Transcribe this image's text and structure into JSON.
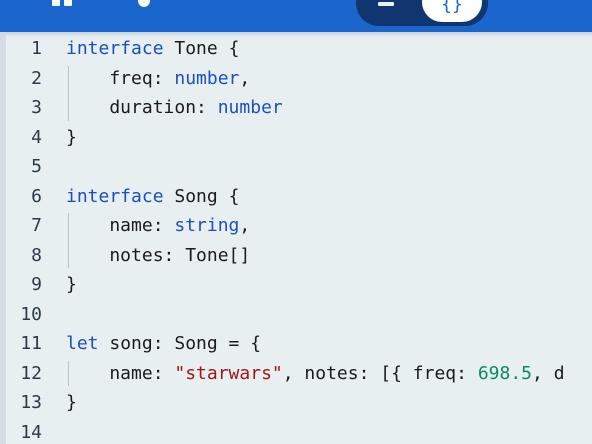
{
  "toolbar": {
    "toggle_icon": "{}",
    "icons": [
      "blocks-icon",
      "blocks-toggle-icon",
      "javascript-braces-icon"
    ]
  },
  "editor": {
    "lines": [
      {
        "number": "1",
        "parts": [
          {
            "t": "interface",
            "c": "kw"
          },
          {
            "t": " Tone {",
            "c": ""
          }
        ]
      },
      {
        "number": "2",
        "parts": [
          {
            "t": "    freq: ",
            "c": ""
          },
          {
            "t": "number",
            "c": "ty"
          },
          {
            "t": ",",
            "c": ""
          }
        ]
      },
      {
        "number": "3",
        "parts": [
          {
            "t": "    duration: ",
            "c": ""
          },
          {
            "t": "number",
            "c": "ty"
          }
        ]
      },
      {
        "number": "4",
        "parts": [
          {
            "t": "}",
            "c": ""
          }
        ]
      },
      {
        "number": "5",
        "parts": []
      },
      {
        "number": "6",
        "parts": [
          {
            "t": "interface",
            "c": "kw"
          },
          {
            "t": " Song {",
            "c": ""
          }
        ]
      },
      {
        "number": "7",
        "parts": [
          {
            "t": "    name: ",
            "c": ""
          },
          {
            "t": "string",
            "c": "ty"
          },
          {
            "t": ",",
            "c": ""
          }
        ]
      },
      {
        "number": "8",
        "parts": [
          {
            "t": "    notes: Tone[]",
            "c": ""
          }
        ]
      },
      {
        "number": "9",
        "parts": [
          {
            "t": "}",
            "c": ""
          }
        ]
      },
      {
        "number": "10",
        "parts": []
      },
      {
        "number": "11",
        "parts": [
          {
            "t": "let",
            "c": "kw"
          },
          {
            "t": " song: Song = {",
            "c": ""
          }
        ]
      },
      {
        "number": "12",
        "parts": [
          {
            "t": "    name: ",
            "c": ""
          },
          {
            "t": "\"starwars\"",
            "c": "str"
          },
          {
            "t": ", notes: [{ freq: ",
            "c": ""
          },
          {
            "t": "698.5",
            "c": "num"
          },
          {
            "t": ", d",
            "c": ""
          }
        ]
      },
      {
        "number": "13",
        "parts": [
          {
            "t": "}",
            "c": ""
          }
        ]
      },
      {
        "number": "14",
        "parts": []
      }
    ]
  },
  "colors": {
    "toolbar_bg": "#1a66cc",
    "editor_bg": "#e8eff0",
    "keyword": "#1a4fbf",
    "string": "#a31515",
    "number": "#0b8a6a"
  }
}
